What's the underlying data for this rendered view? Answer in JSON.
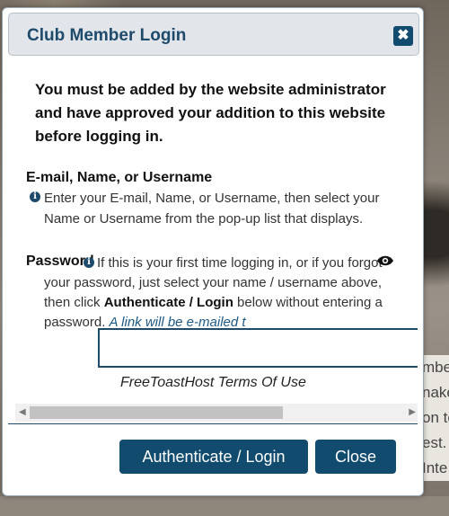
{
  "background": {
    "side_text": [
      "mbe",
      "nake",
      "on to",
      "est.",
      "Inte"
    ]
  },
  "dialog": {
    "title": "Club Member Login",
    "close_glyph": "✖",
    "notice": "You must be added by the website administrator and have approved your addition to this website before logging in.",
    "username": {
      "label": "E-mail, Name, or Username",
      "help": "Enter your E-mail, Name, or Username, then select your Name or Username from the pop-up list that displays."
    },
    "password": {
      "label": "Password",
      "help_part1": "If this is your first time logging in, or if you forgot your password, just select your name / username above, then click ",
      "help_bold": "Authenticate / Login",
      "help_part2": " below without entering a password. ",
      "help_link": "A link will be e-mailed t",
      "value": ""
    },
    "terms_link": "FreeToastHost Terms Of Use",
    "buttons": {
      "login": "Authenticate / Login",
      "close": "Close"
    },
    "icons": {
      "info": "info-icon",
      "eye": "eye-icon",
      "close": "close-icon"
    },
    "colors": {
      "accent": "#114b6e",
      "title": "#1e4a6b"
    }
  }
}
